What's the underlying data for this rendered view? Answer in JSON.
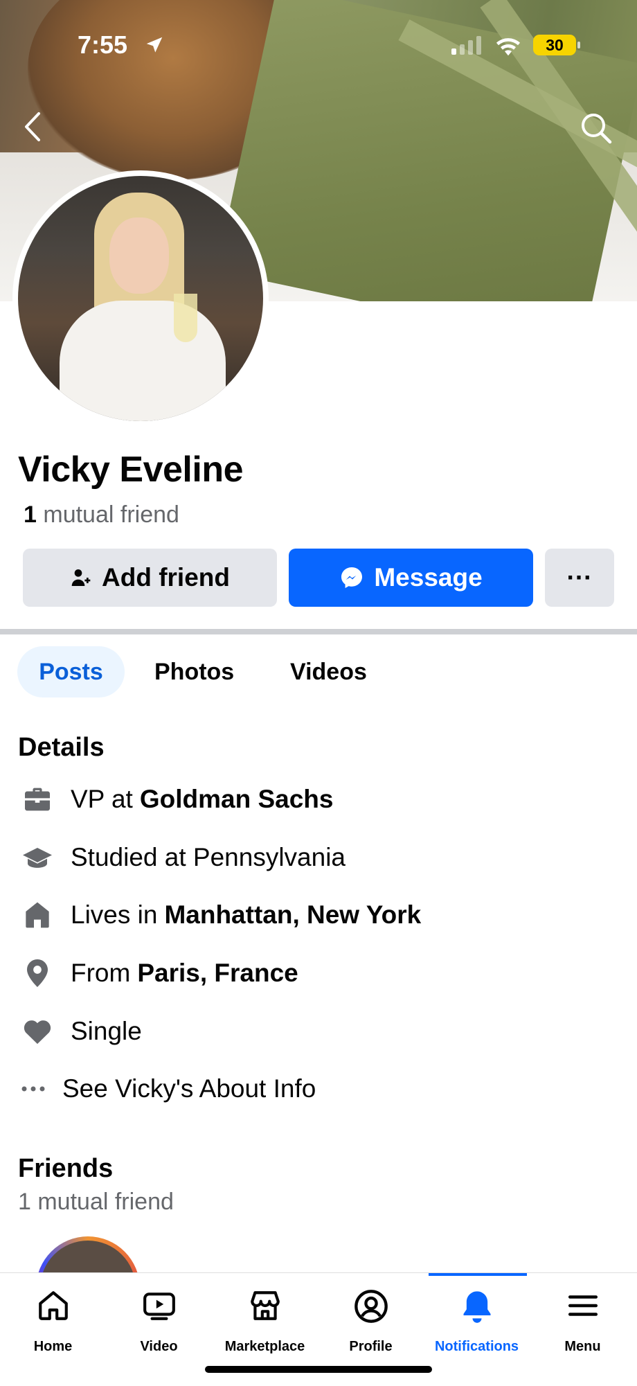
{
  "status_bar": {
    "time": "7:55",
    "battery": "30"
  },
  "profile": {
    "name": "Vicky Eveline",
    "mutual_count": "1",
    "mutual_label": "mutual friend"
  },
  "actions": {
    "add_friend": "Add friend",
    "message": "Message",
    "more": "···"
  },
  "tabs": [
    {
      "label": "Posts",
      "active": true
    },
    {
      "label": "Photos"
    },
    {
      "label": "Videos"
    }
  ],
  "details": {
    "title": "Details",
    "items": [
      {
        "icon": "briefcase-icon",
        "prefix": "VP at",
        "bold": "Goldman Sachs"
      },
      {
        "icon": "graduation-cap-icon",
        "prefix": "Studied at Pennsylvania",
        "bold": ""
      },
      {
        "icon": "house-icon",
        "prefix": "Lives in",
        "bold": "Manhattan, New York"
      },
      {
        "icon": "location-pin-icon",
        "prefix": "From",
        "bold": "Paris, France"
      },
      {
        "icon": "heart-icon",
        "prefix": "Single",
        "bold": ""
      },
      {
        "icon": "more-dots-icon",
        "prefix": "See Vicky's About Info",
        "bold": ""
      }
    ]
  },
  "friends": {
    "title": "Friends",
    "subtitle": "1 mutual friend"
  },
  "bottom_nav": [
    {
      "label": "Home",
      "icon": "home-icon"
    },
    {
      "label": "Video",
      "icon": "video-icon"
    },
    {
      "label": "Marketplace",
      "icon": "marketplace-icon"
    },
    {
      "label": "Profile",
      "icon": "profile-icon"
    },
    {
      "label": "Notifications",
      "icon": "bell-icon",
      "active": true
    },
    {
      "label": "Menu",
      "icon": "menu-icon"
    }
  ],
  "colors": {
    "accent": "#0866ff",
    "button_gray": "#e4e6eb",
    "secondary_text": "#65676b"
  }
}
